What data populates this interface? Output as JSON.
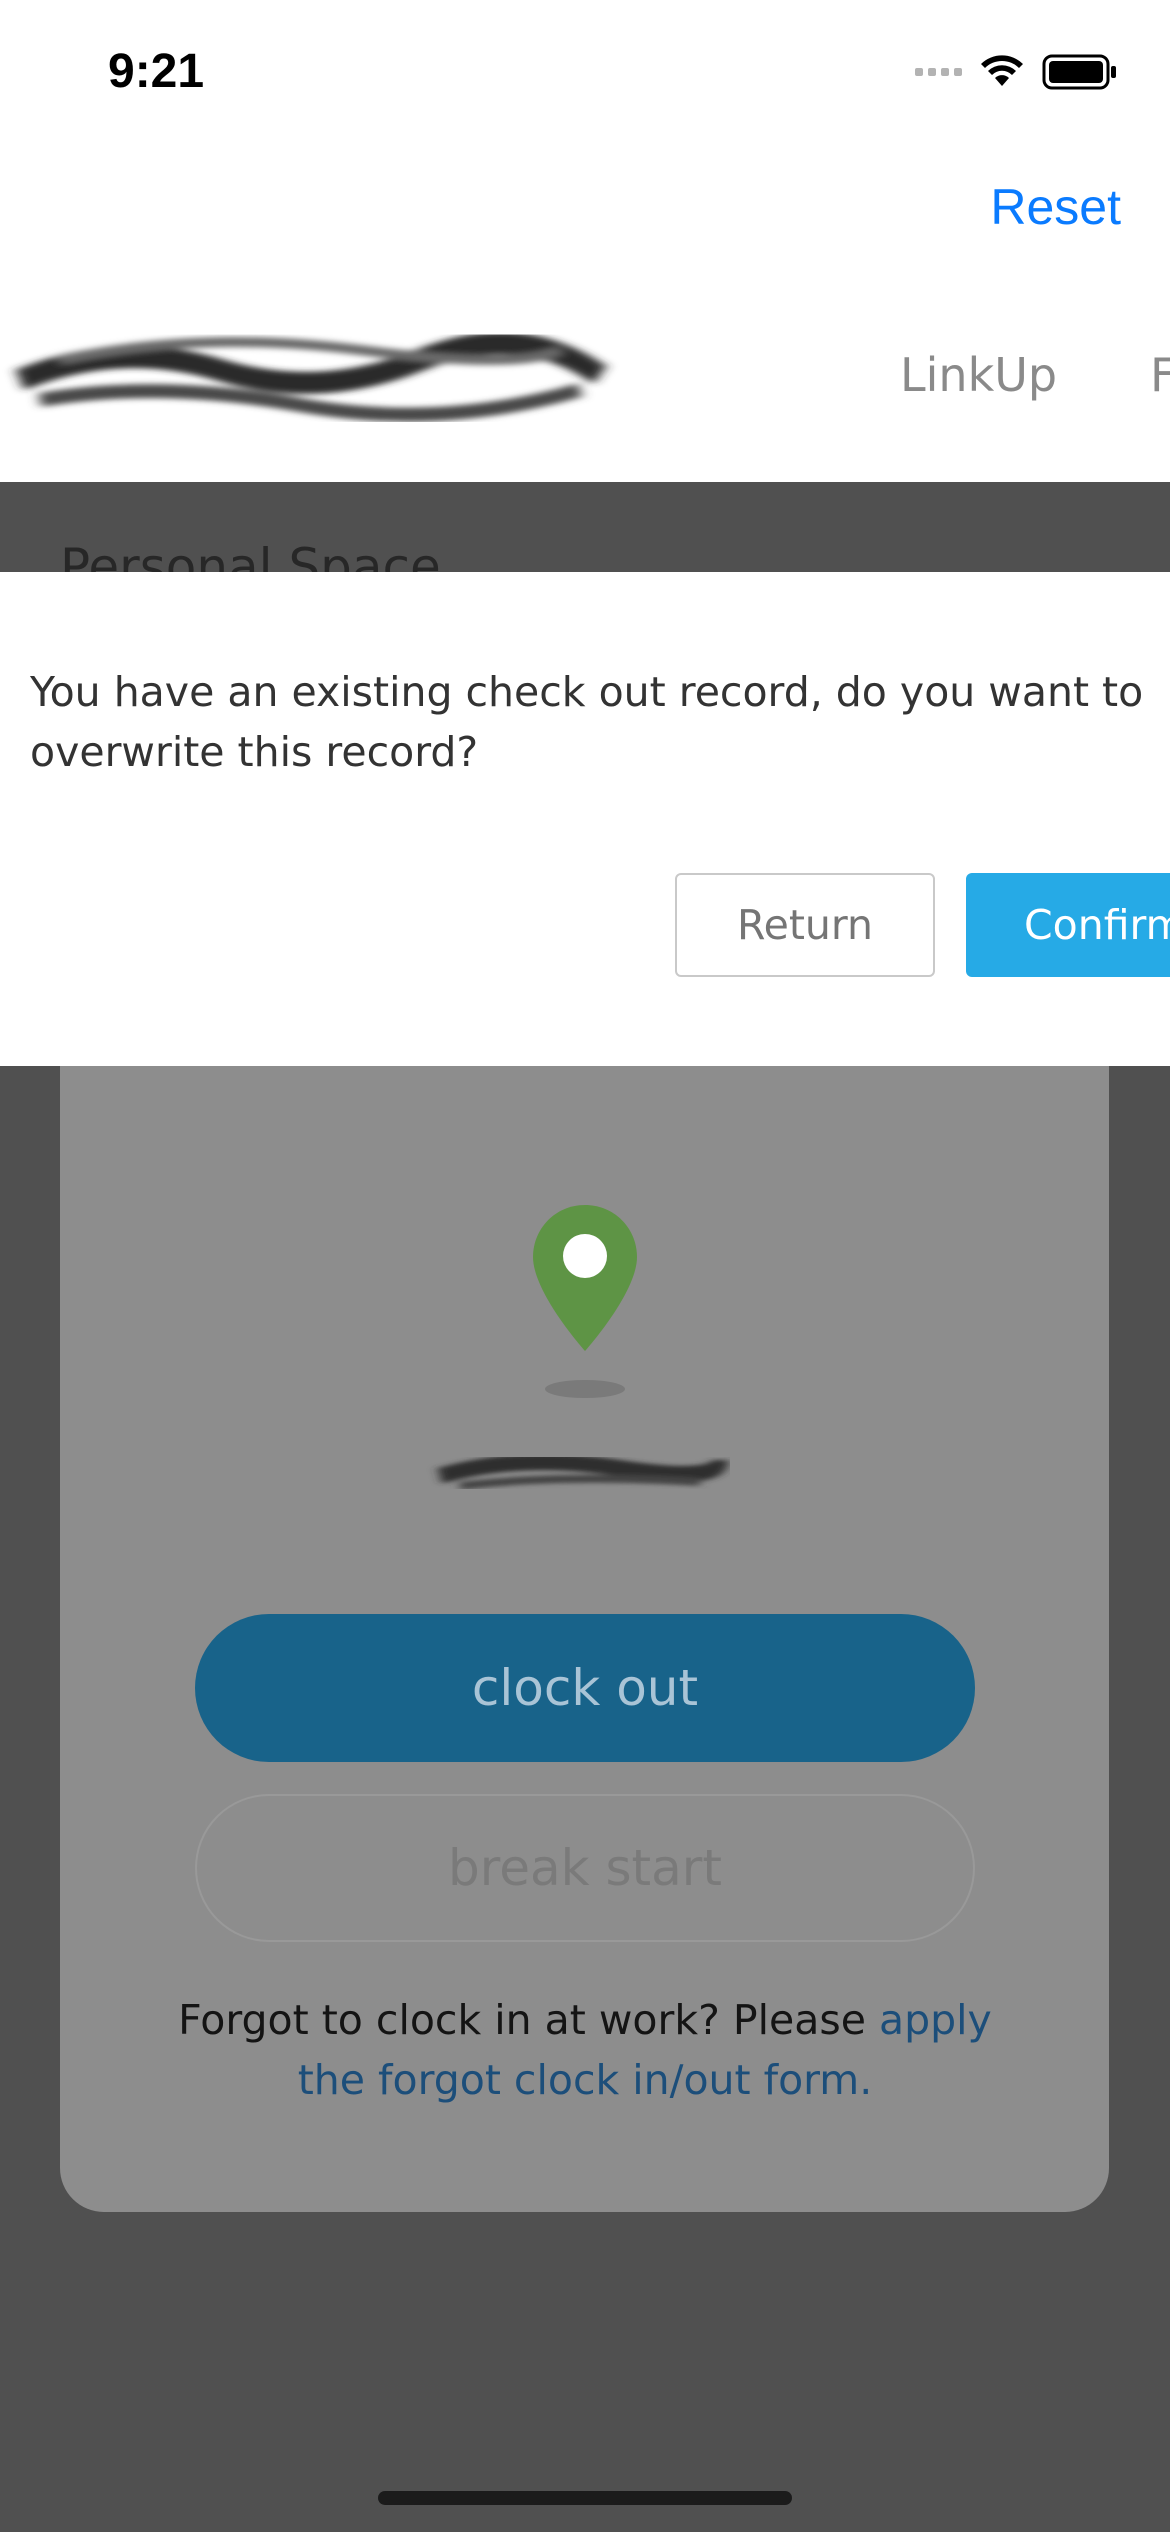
{
  "status_bar": {
    "time": "9:21"
  },
  "header": {
    "reset_label": "Reset",
    "tabs": [
      {
        "label": "LinkUp"
      },
      {
        "label": "F"
      }
    ]
  },
  "background": {
    "section_title": "Personal Space",
    "clock_out_label": "clock out",
    "break_start_label": "break start",
    "forgot_text": "Forgot to clock in at work? Please ",
    "forgot_link": "apply the forgot clock in/out form."
  },
  "dialog": {
    "message": "You have an existing check out record, do you want to overwrite this record?",
    "return_label": "Return",
    "confirm_label": "Confirm"
  },
  "colors": {
    "accent": "#0a7bff",
    "confirm": "#26aae6",
    "pin": "#5e9445",
    "clock_out": "#18638a"
  }
}
